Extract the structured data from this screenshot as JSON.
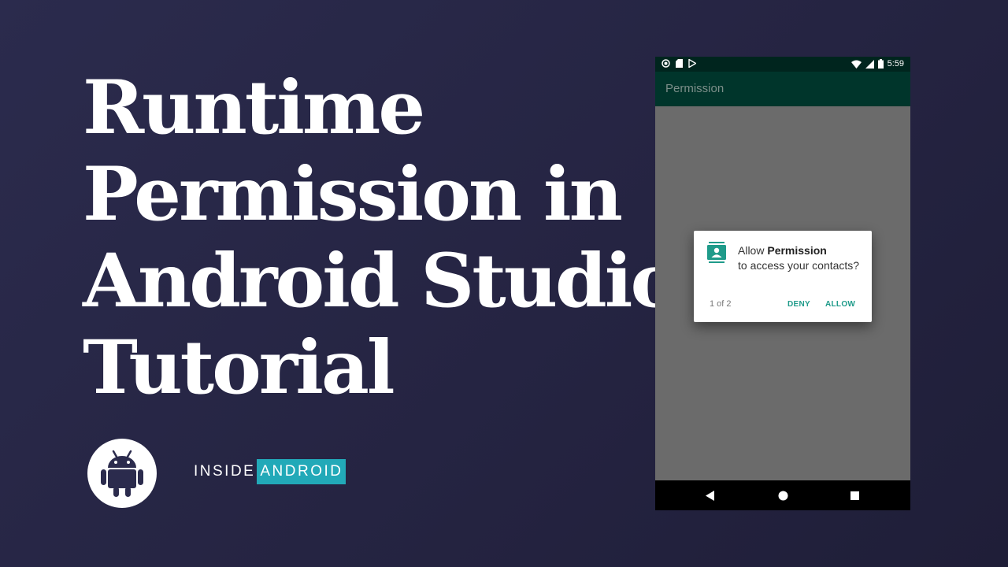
{
  "title": {
    "lines": [
      "Runtime",
      "Permission in",
      "Android Studio",
      "Tutorial"
    ]
  },
  "brand": {
    "part1": "INSIDE",
    "part2": "ANDROID",
    "accent_color": "#22a9b8"
  },
  "phone": {
    "status_bar": {
      "time": "5:59",
      "left_icons": [
        "record-icon",
        "sd-card-icon",
        "play-store-icon"
      ],
      "right_icons": [
        "wifi-icon",
        "signal-icon",
        "battery-icon"
      ]
    },
    "app_bar": {
      "title": "Permission",
      "color": "#00352b"
    },
    "dialog": {
      "text_prefix": "Allow ",
      "app_name": "Permission",
      "text_suffix": "to access your contacts?",
      "counter": "1 of 2",
      "deny_label": "DENY",
      "allow_label": "ALLOW",
      "accent_color": "#1f9b8a",
      "icon": "contacts-icon"
    },
    "nav_bar": {
      "buttons": [
        "back-icon",
        "home-icon",
        "recents-icon"
      ]
    }
  }
}
